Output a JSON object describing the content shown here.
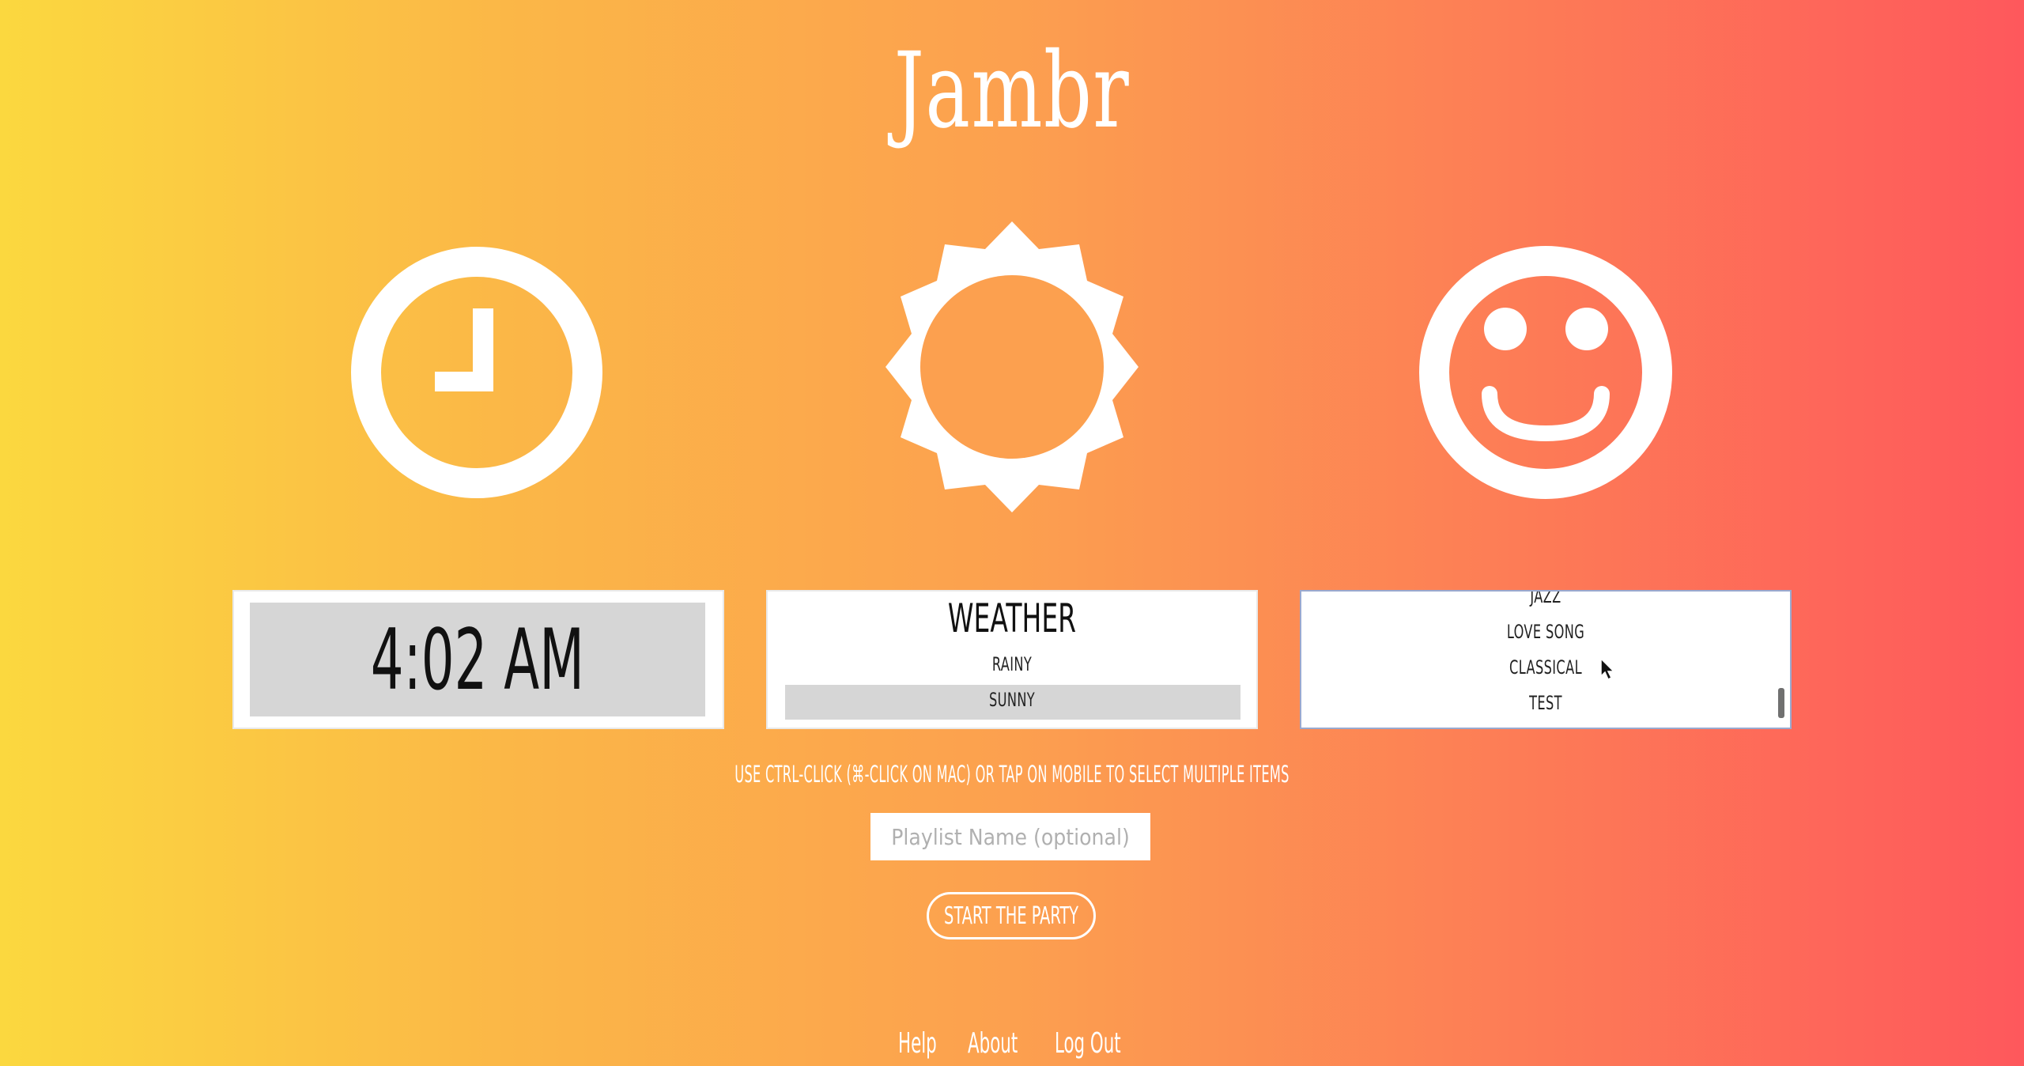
{
  "app": {
    "title": "Jambr"
  },
  "icons": {
    "clock": "clock-icon",
    "sun": "sun-icon",
    "smiley": "smiley-face-icon"
  },
  "time_panel": {
    "value": "4:02 AM"
  },
  "weather_panel": {
    "header": "WEATHER",
    "options": [
      "RAINY",
      "SUNNY"
    ],
    "selected": "SUNNY"
  },
  "mood_panel": {
    "options": [
      "JAZZ",
      "LOVE SONG",
      "CLASSICAL",
      "TEST"
    ]
  },
  "hint": "USE CTRL-CLICK (⌘-CLICK ON MAC) OR TAP ON MOBILE TO SELECT MULTIPLE ITEMS",
  "playlist": {
    "placeholder": "Playlist Name (optional)",
    "value": ""
  },
  "start_button": {
    "label": "START THE PARTY"
  },
  "footer": {
    "links": [
      "Help",
      "About",
      "Log Out"
    ]
  },
  "colors": {
    "gradient_left": "#fbd83f",
    "gradient_mid": "#fca04f",
    "gradient_right": "#fe585c",
    "panel_selected": "#d6d6d6"
  }
}
